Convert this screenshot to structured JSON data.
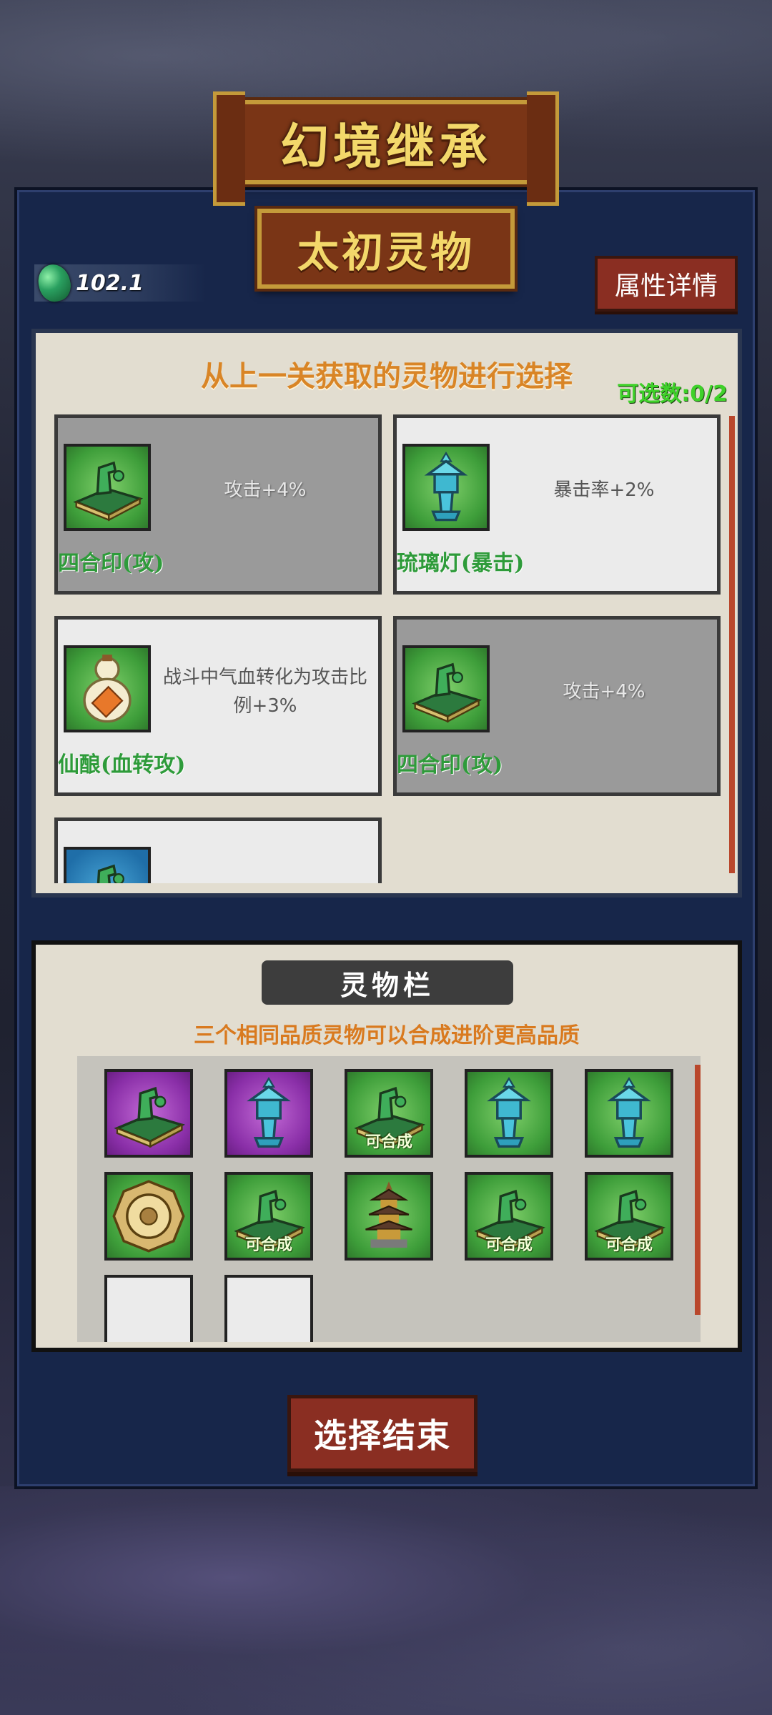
{
  "title": "幻境继承",
  "subtitle": "太初灵物",
  "currency": {
    "value": "102.1",
    "icon": "jade-gem-icon"
  },
  "attr_button": "属性详情",
  "selection": {
    "heading": "从上一关获取的灵物进行选择",
    "count": "可选数:0/2",
    "cards": [
      {
        "name": "四合印(攻)",
        "desc": "攻击+4%",
        "state": "dim",
        "icon": "seal-icon",
        "frame": "green"
      },
      {
        "name": "琉璃灯(暴击)",
        "desc": "暴击率+2%",
        "state": "lit",
        "icon": "lamp-icon",
        "frame": "green"
      },
      {
        "name": "仙酿(血转攻)",
        "desc": "战斗中气血转化为攻击比例+3%",
        "state": "lit",
        "icon": "gourd-icon",
        "frame": "green"
      },
      {
        "name": "四合印(攻)",
        "desc": "攻击+4%",
        "state": "dim",
        "icon": "seal-icon",
        "frame": "green"
      },
      {
        "name": "",
        "desc": "",
        "state": "lit",
        "icon": "seal-icon",
        "frame": "blue"
      }
    ]
  },
  "inventory": {
    "title": "灵物栏",
    "hint": "三个相同品质灵物可以合成进阶更高品质",
    "merge_label": "可合成",
    "slots": [
      {
        "icon": "seal-icon",
        "frame": "purple",
        "mergeable": false
      },
      {
        "icon": "lamp-icon",
        "frame": "purple",
        "mergeable": false
      },
      {
        "icon": "seal-icon",
        "frame": "green",
        "mergeable": true
      },
      {
        "icon": "lamp-icon",
        "frame": "green",
        "mergeable": false
      },
      {
        "icon": "lamp-icon",
        "frame": "green",
        "mergeable": false
      },
      {
        "icon": "compass-icon",
        "frame": "green",
        "mergeable": false
      },
      {
        "icon": "seal-icon",
        "frame": "green",
        "mergeable": true
      },
      {
        "icon": "pagoda-icon",
        "frame": "green",
        "mergeable": false
      },
      {
        "icon": "seal-icon",
        "frame": "green",
        "mergeable": true
      },
      {
        "icon": "seal-icon",
        "frame": "green",
        "mergeable": true
      },
      {
        "icon": "",
        "frame": "empty",
        "mergeable": false
      },
      {
        "icon": "",
        "frame": "empty",
        "mergeable": false
      }
    ]
  },
  "end_button": "选择结束"
}
